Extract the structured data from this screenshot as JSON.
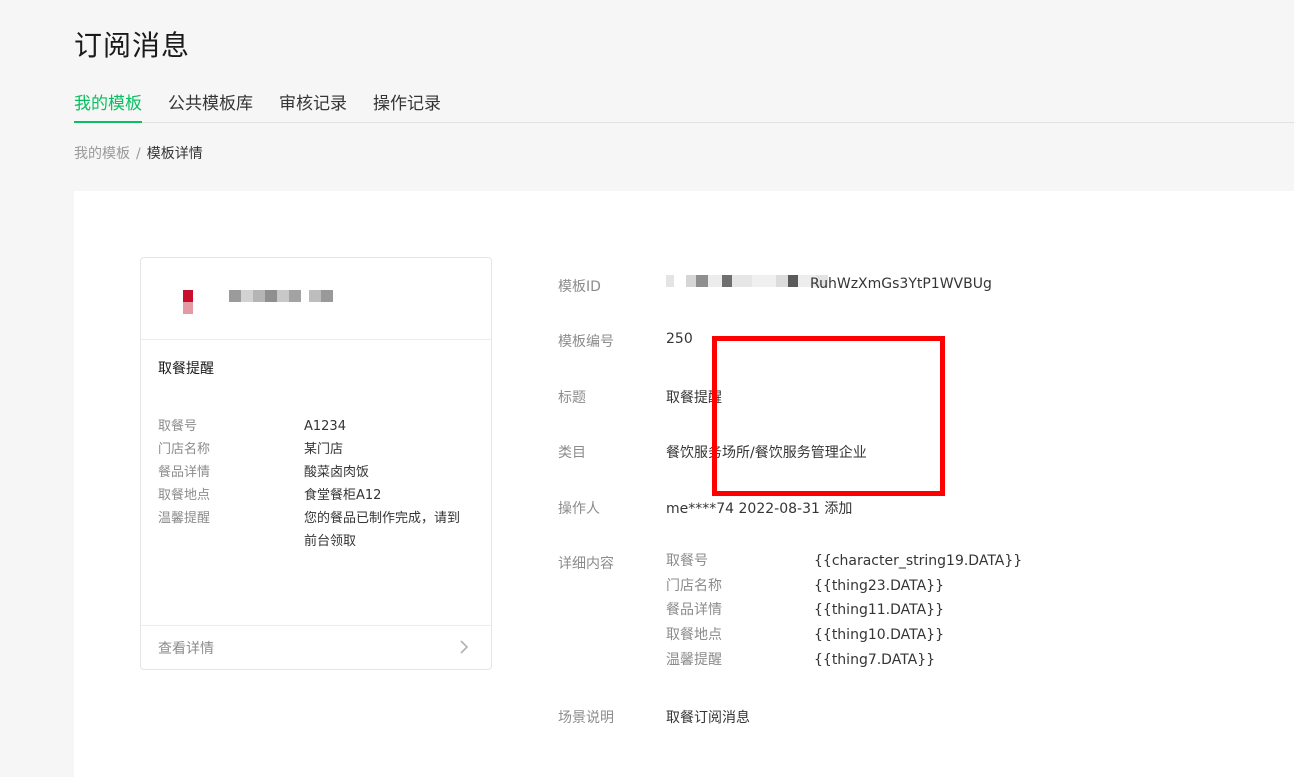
{
  "header": {
    "title": "订阅消息"
  },
  "tabs": [
    {
      "label": "我的模板",
      "active": true
    },
    {
      "label": "公共模板库",
      "active": false
    },
    {
      "label": "审核记录",
      "active": false
    },
    {
      "label": "操作记录",
      "active": false
    }
  ],
  "breadcrumb": {
    "parent": "我的模板",
    "separator": "/",
    "current": "模板详情"
  },
  "preview": {
    "title": "取餐提醒",
    "fields": [
      {
        "key": "取餐号",
        "value": "A1234"
      },
      {
        "key": "门店名称",
        "value": "某门店"
      },
      {
        "key": "餐品详情",
        "value": "酸菜卤肉饭"
      },
      {
        "key": "取餐地点",
        "value": "食堂餐柜A12"
      },
      {
        "key": "温馨提醒",
        "value": "您的餐品已制作完成，请到前台领取"
      }
    ],
    "footer_label": "查看详情"
  },
  "info": {
    "template_id_label": "模板ID",
    "template_id_visible": "RuhWzXmGs3YtP1WVBUg",
    "template_no_label": "模板编号",
    "template_no": "250",
    "title_label": "标题",
    "title": "取餐提醒",
    "category_label": "类目",
    "category": "餐饮服务场所/餐饮服务管理企业",
    "operator_label": "操作人",
    "operator": "me****74 2022-08-31 添加",
    "details_label": "详细内容",
    "details": [
      {
        "key": "取餐号",
        "value": "{{character_string19.DATA}}"
      },
      {
        "key": "门店名称",
        "value": "{{thing23.DATA}}"
      },
      {
        "key": "餐品详情",
        "value": "{{thing11.DATA}}"
      },
      {
        "key": "取餐地点",
        "value": "{{thing10.DATA}}"
      },
      {
        "key": "温馨提醒",
        "value": "{{thing7.DATA}}"
      }
    ],
    "scene_label": "场景说明",
    "scene": "取餐订阅消息"
  },
  "colors": {
    "accent": "#07c160",
    "highlight": "#ff0000",
    "logo": "#c8102e"
  }
}
